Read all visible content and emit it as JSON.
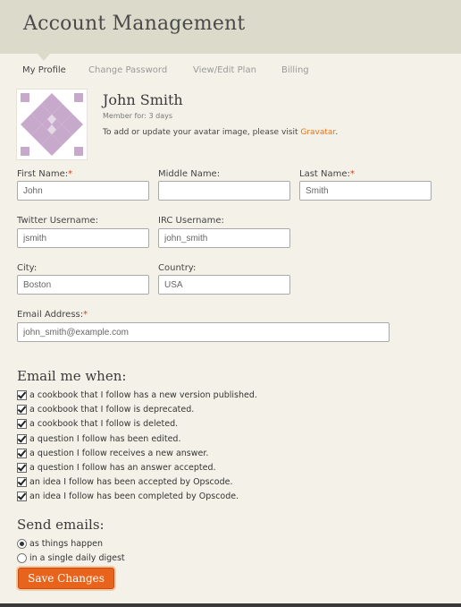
{
  "header": {
    "title": "Account Management"
  },
  "tabs": [
    {
      "label": "My Profile",
      "active": true
    },
    {
      "label": "Change Password",
      "active": false
    },
    {
      "label": "View/Edit Plan",
      "active": false
    },
    {
      "label": "Billing",
      "active": false
    }
  ],
  "profile": {
    "name": "John Smith",
    "member_for": "Member for: 3 days",
    "avatar_note": "To add or update your avatar image, please visit ",
    "avatar_link": "Gravatar",
    "avatar_note_end": "."
  },
  "form": {
    "required_mark": "*",
    "first_name": {
      "label": "First Name:",
      "value": "John"
    },
    "middle_name": {
      "label": "Middle Name:",
      "value": ""
    },
    "last_name": {
      "label": "Last Name:",
      "value": "Smith"
    },
    "twitter": {
      "label": "Twitter Username:",
      "value": "jsmith"
    },
    "irc": {
      "label": "IRC Username:",
      "value": "john_smith"
    },
    "city": {
      "label": "City:",
      "value": "Boston"
    },
    "country": {
      "label": "Country:",
      "value": "USA"
    },
    "email": {
      "label": "Email Address:",
      "value": "john_smith@example.com"
    }
  },
  "email_me": {
    "title": "Email me when:",
    "options": [
      {
        "label": "a cookbook that I follow has a new version published.",
        "checked": true
      },
      {
        "label": "a cookbook that I follow is deprecated.",
        "checked": true
      },
      {
        "label": "a cookbook that I follow is deleted.",
        "checked": true
      },
      {
        "label": "a question I follow has been edited.",
        "checked": true
      },
      {
        "label": "a question I follow receives a new answer.",
        "checked": true
      },
      {
        "label": "a question I follow has an answer accepted.",
        "checked": true
      },
      {
        "label": "an idea I follow has been accepted by Opscode.",
        "checked": true
      },
      {
        "label": "an idea I follow has been completed by Opscode.",
        "checked": true
      }
    ]
  },
  "send_emails": {
    "title": "Send emails:",
    "options": [
      {
        "label": "as things happen",
        "selected": true
      },
      {
        "label": "in a single daily digest",
        "selected": false
      }
    ]
  },
  "save_label": "Save Changes",
  "colors": {
    "accent": "#e8641c",
    "header_bg": "#dcdacb",
    "page_bg": "#f4f2e8",
    "required": "#d9421e",
    "link": "#e8721c"
  },
  "icons": {
    "avatar": "quilt-pattern-avatar",
    "checkbox": "checkbox-checked-icon",
    "radio": "radio-icon"
  }
}
